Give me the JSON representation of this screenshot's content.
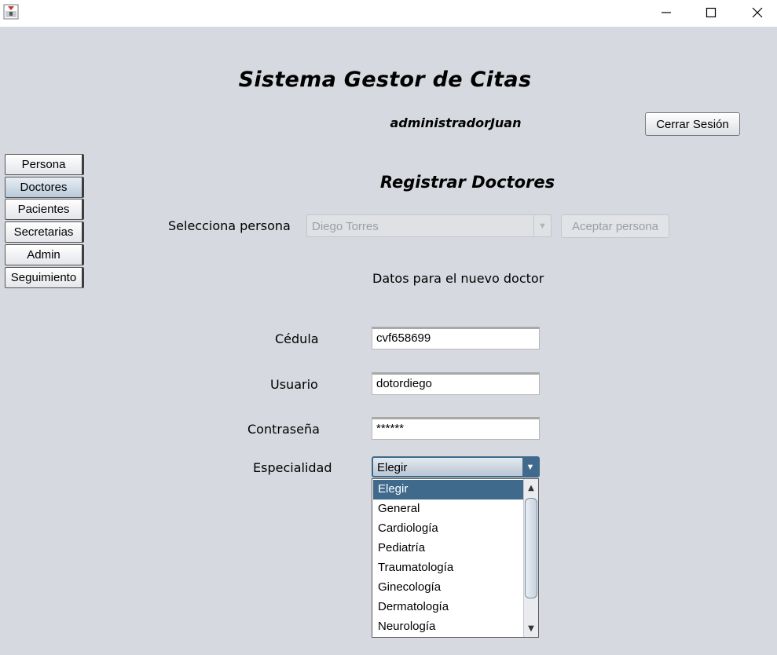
{
  "window": {
    "minimize_icon": "minimize-icon",
    "maximize_icon": "maximize-icon",
    "close_icon": "close-icon"
  },
  "header": {
    "title": "Sistema Gestor de Citas",
    "username": "administradorJuan",
    "logout_label": "Cerrar Sesión"
  },
  "sidebar": {
    "items": [
      {
        "label": "Persona",
        "active": false
      },
      {
        "label": "Doctores",
        "active": true
      },
      {
        "label": "Pacientes",
        "active": false
      },
      {
        "label": "Secretarias",
        "active": false
      },
      {
        "label": "Admin",
        "active": false
      },
      {
        "label": "Seguimiento",
        "active": false
      }
    ]
  },
  "form": {
    "section_title": "Registrar Doctores",
    "select_person_label": "Selecciona persona",
    "select_person_value": "Diego Torres",
    "accept_person_label": "Aceptar persona",
    "subtitle": "Datos para el nuevo doctor",
    "cedula_label": "Cédula",
    "cedula_value": "cvf658699",
    "usuario_label": "Usuario",
    "usuario_value": "dotordiego",
    "password_label": "Contraseña",
    "password_value": "******",
    "especialidad_label": "Especialidad",
    "especialidad_value": "Elegir",
    "especialidad_options": [
      "Elegir",
      "General",
      "Cardiología",
      "Pediatría",
      "Traumatología",
      "Ginecología",
      "Dermatología",
      "Neurología"
    ]
  },
  "colors": {
    "background": "#d6d9df",
    "selection": "#3f6a8c",
    "active_tab": "#b8cad9"
  }
}
